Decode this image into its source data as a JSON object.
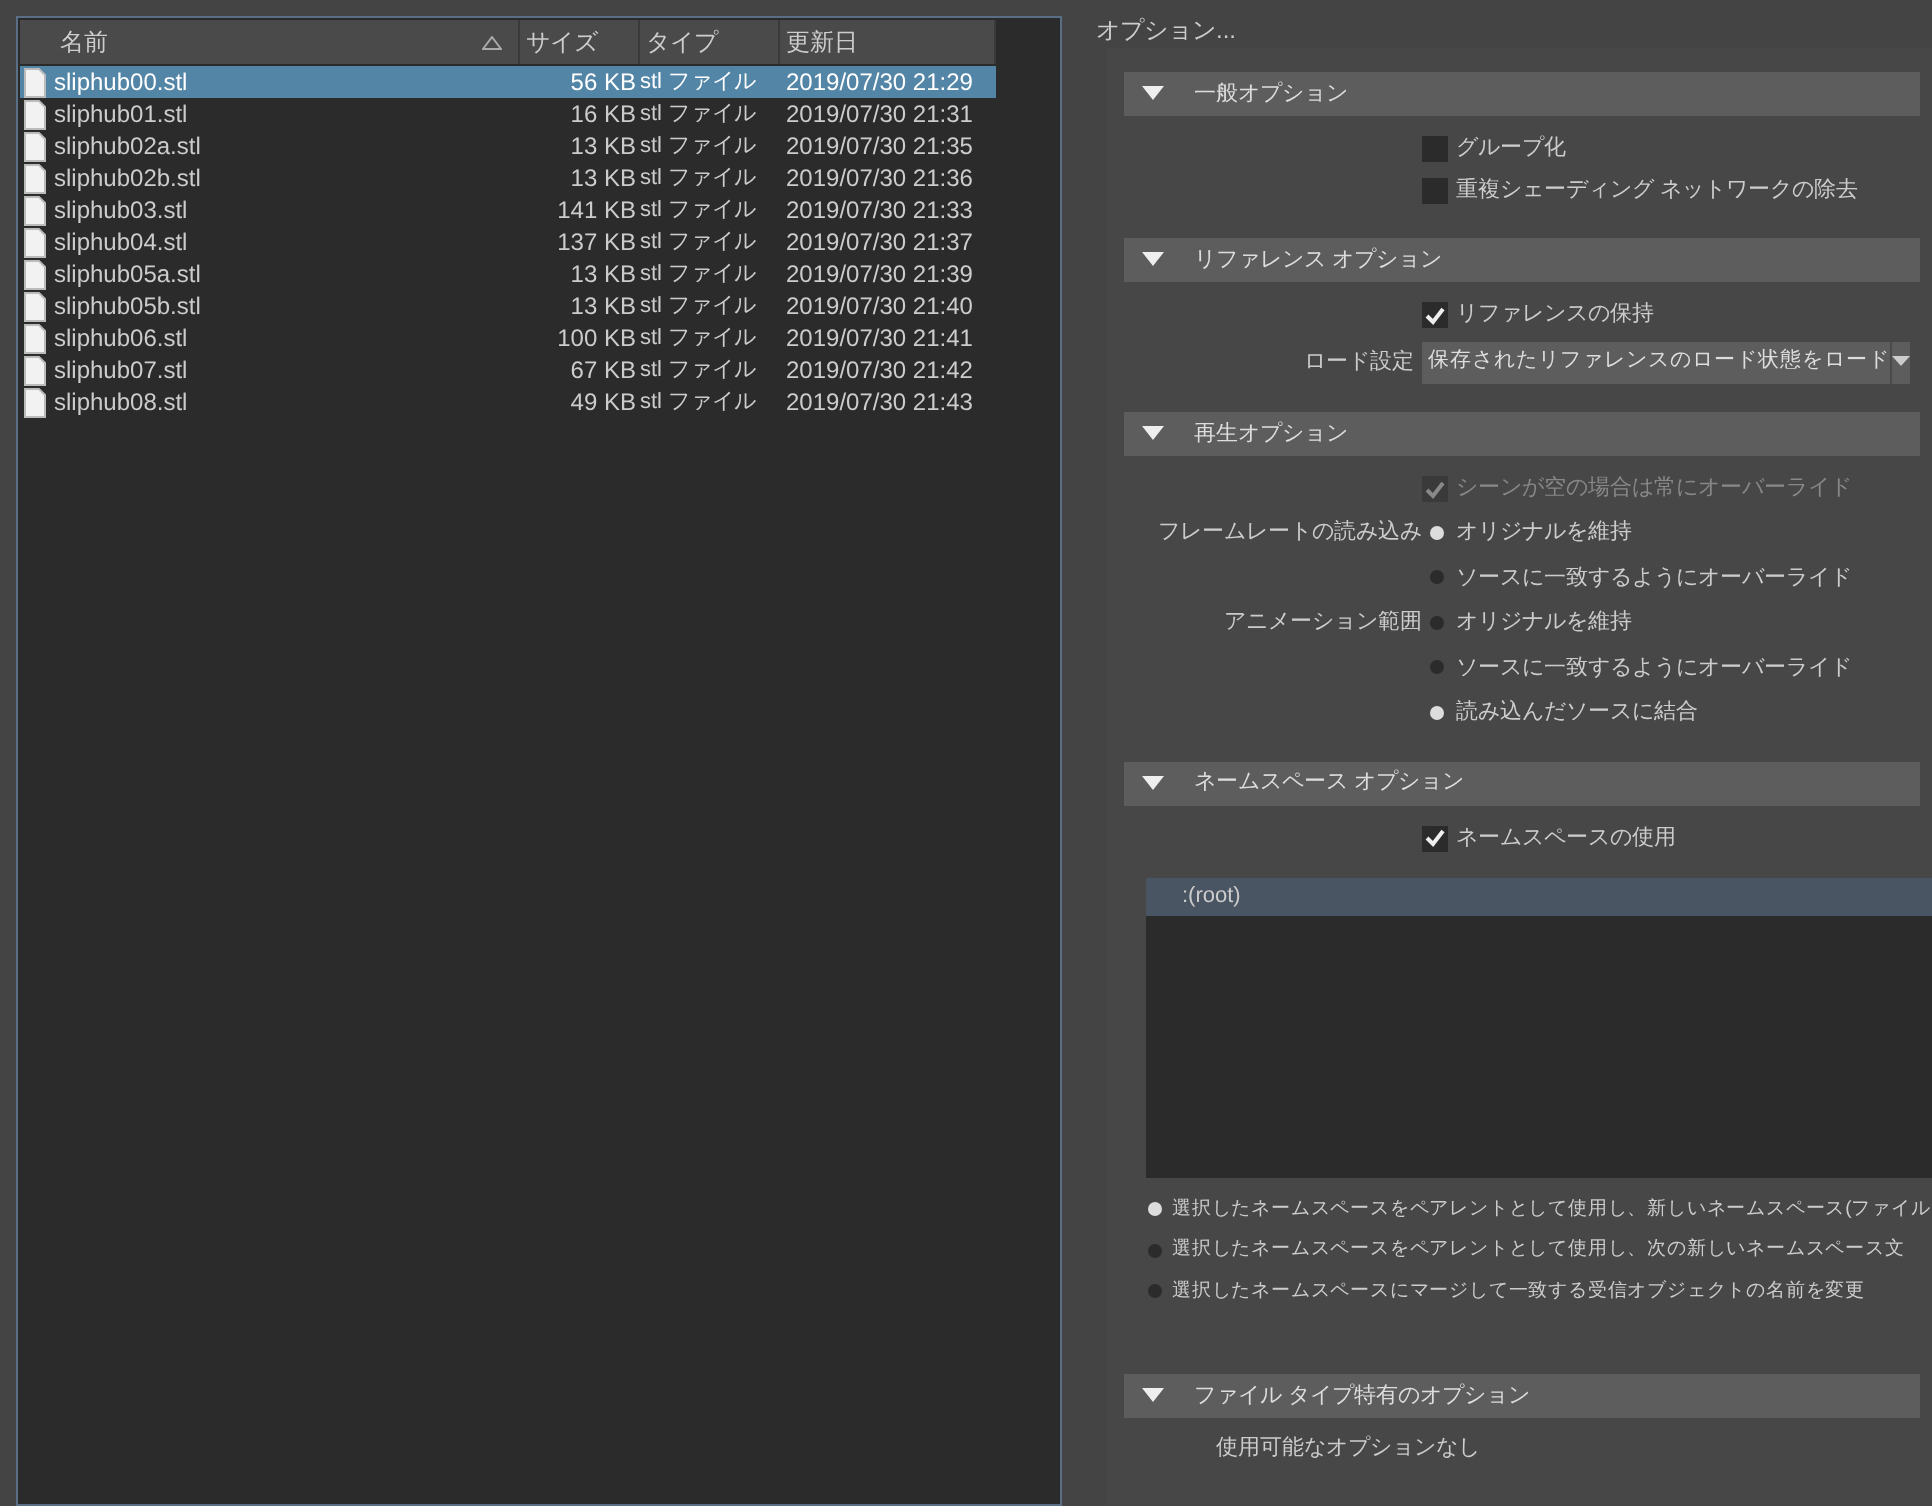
{
  "file_list": {
    "columns": [
      {
        "label": "名前",
        "sorted": true
      },
      {
        "label": "サイズ",
        "sorted": false
      },
      {
        "label": "タイプ",
        "sorted": false
      },
      {
        "label": "更新日",
        "sorted": false
      }
    ],
    "rows": [
      {
        "name": "sliphub00.stl",
        "size": "56 KB",
        "type": "stl ファイル",
        "modified": "2019/07/30 21:29",
        "selected": true
      },
      {
        "name": "sliphub01.stl",
        "size": "16 KB",
        "type": "stl ファイル",
        "modified": "2019/07/30 21:31",
        "selected": false
      },
      {
        "name": "sliphub02a.stl",
        "size": "13 KB",
        "type": "stl ファイル",
        "modified": "2019/07/30 21:35",
        "selected": false
      },
      {
        "name": "sliphub02b.stl",
        "size": "13 KB",
        "type": "stl ファイル",
        "modified": "2019/07/30 21:36",
        "selected": false
      },
      {
        "name": "sliphub03.stl",
        "size": "141 KB",
        "type": "stl ファイル",
        "modified": "2019/07/30 21:33",
        "selected": false
      },
      {
        "name": "sliphub04.stl",
        "size": "137 KB",
        "type": "stl ファイル",
        "modified": "2019/07/30 21:37",
        "selected": false
      },
      {
        "name": "sliphub05a.stl",
        "size": "13 KB",
        "type": "stl ファイル",
        "modified": "2019/07/30 21:39",
        "selected": false
      },
      {
        "name": "sliphub05b.stl",
        "size": "13 KB",
        "type": "stl ファイル",
        "modified": "2019/07/30 21:40",
        "selected": false
      },
      {
        "name": "sliphub06.stl",
        "size": "100 KB",
        "type": "stl ファイル",
        "modified": "2019/07/30 21:41",
        "selected": false
      },
      {
        "name": "sliphub07.stl",
        "size": "67 KB",
        "type": "stl ファイル",
        "modified": "2019/07/30 21:42",
        "selected": false
      },
      {
        "name": "sliphub08.stl",
        "size": "49 KB",
        "type": "stl ファイル",
        "modified": "2019/07/30 21:43",
        "selected": false
      }
    ]
  },
  "options": {
    "title": "オプション...",
    "sections": [
      {
        "title": "一般オプション",
        "expanded": true,
        "items": [
          {
            "kind": "checkbox",
            "label": "グループ化",
            "checked": false,
            "disabled": false
          },
          {
            "kind": "checkbox",
            "label": "重複シェーディング ネットワークの除去",
            "checked": false,
            "disabled": false
          }
        ]
      },
      {
        "title": "リファレンス オプション",
        "expanded": true,
        "items": [
          {
            "kind": "checkbox",
            "label": "リファレンスの保持",
            "checked": true,
            "disabled": false
          },
          {
            "kind": "dropdown",
            "label": "ロード設定",
            "value": "保存されたリファレンスのロード状態をロード"
          }
        ]
      },
      {
        "title": "再生オプション",
        "expanded": true,
        "items": [
          {
            "kind": "checkbox",
            "label": "シーンが空の場合は常にオーバーライド",
            "checked": true,
            "disabled": true
          },
          {
            "kind": "radio",
            "group_label": "フレームレートの読み込み",
            "label": "オリジナルを維持",
            "selected": true
          },
          {
            "kind": "radio",
            "label": "ソースに一致するようにオーバーライド",
            "selected": false
          },
          {
            "kind": "radio",
            "group_label": "アニメーション範囲",
            "label": "オリジナルを維持",
            "selected": false
          },
          {
            "kind": "radio",
            "label": "ソースに一致するようにオーバーライド",
            "selected": false
          },
          {
            "kind": "radio",
            "label": "読み込んだソースに結合",
            "selected": true
          }
        ]
      },
      {
        "title": "ネームスペース オプション",
        "expanded": true,
        "items": [
          {
            "kind": "checkbox",
            "label": "ネームスペースの使用",
            "checked": true,
            "disabled": false
          },
          {
            "kind": "list",
            "entries": [
              {
                "label": ":(root)",
                "selected": true
              }
            ]
          },
          {
            "kind": "wide_radio",
            "label": "選択したネームスペースをペアレントとして使用し、新しいネームスペース(ファイル",
            "selected": true
          },
          {
            "kind": "wide_radio",
            "label": "選択したネームスペースをペアレントとして使用し、次の新しいネームスペース文",
            "selected": false
          },
          {
            "kind": "wide_radio",
            "label": "選択したネームスペースにマージして一致する受信オブジェクトの名前を変更",
            "selected": false
          }
        ]
      },
      {
        "title": "ファイル タイプ特有のオプション",
        "expanded": true,
        "items": [
          {
            "kind": "note",
            "text": "使用可能なオプションなし"
          }
        ]
      }
    ]
  }
}
